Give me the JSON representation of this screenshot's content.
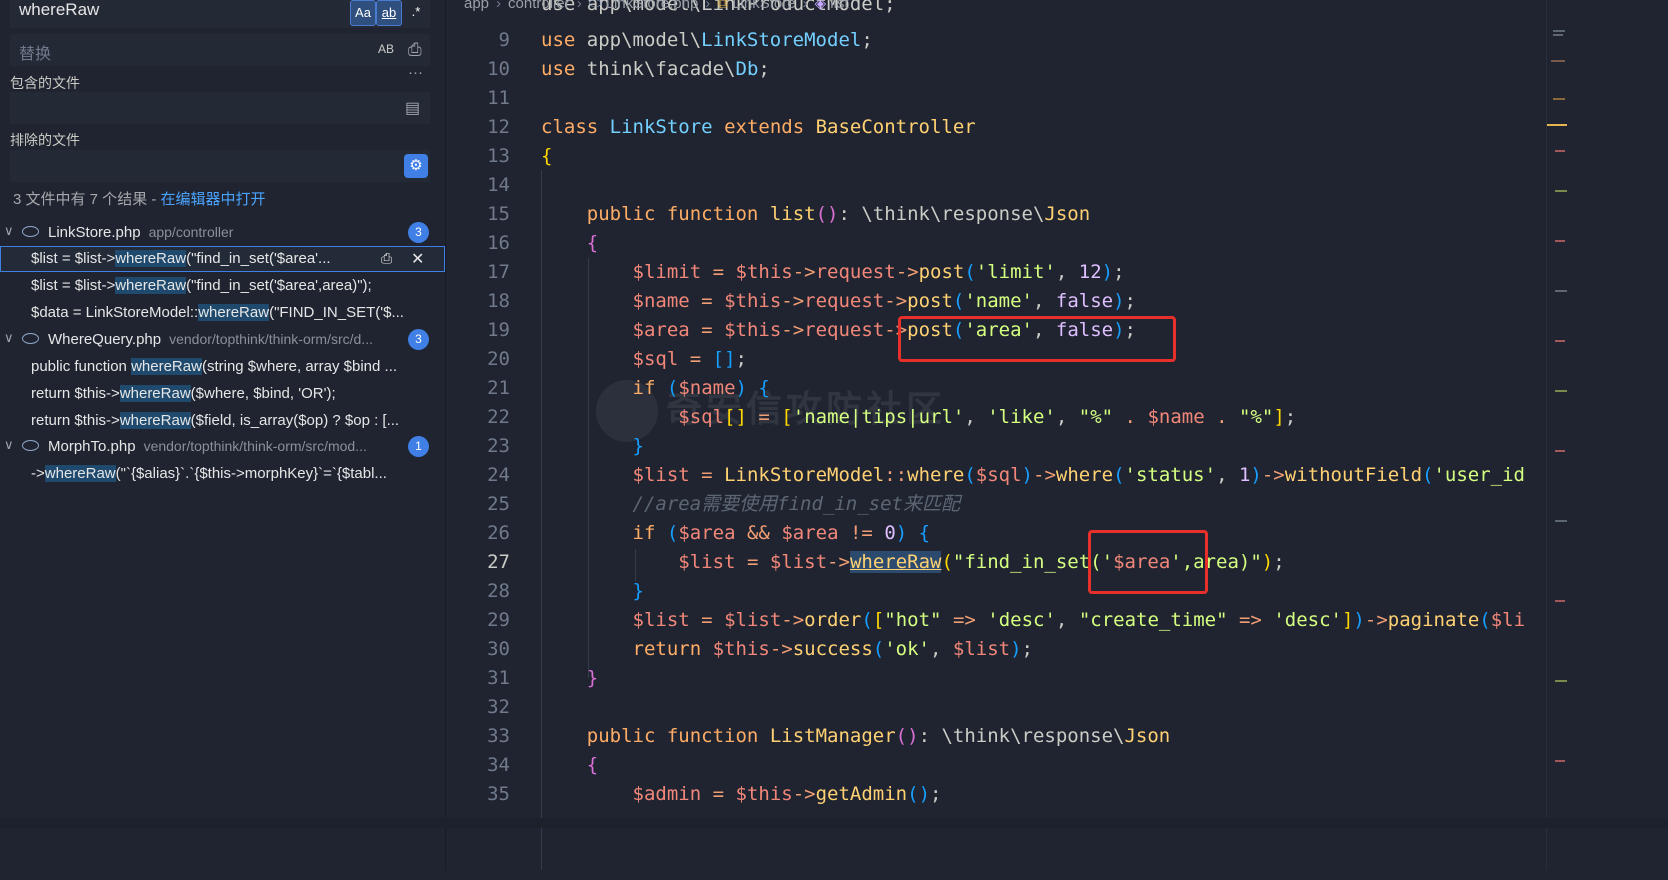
{
  "search": {
    "query": "whereRaw",
    "opt_case": "Aa",
    "opt_word": "ab",
    "opt_regex": ".*",
    "replace_placeholder": "替换",
    "replace_all": "AB",
    "include_label": "包含的文件",
    "exclude_label": "排除的文件",
    "summary": "3 文件中有 7 个结果 - ",
    "open_in_editor": "在编辑器中打开",
    "more": "···"
  },
  "results": [
    {
      "file": "LinkStore.php",
      "path": "app/controller",
      "count": "3",
      "matches": [
        {
          "pre": "$list = $list->",
          "hit": "whereRaw",
          "post": "(\"find_in_set('$area'..."
        },
        {
          "pre": "$list = $list->",
          "hit": "whereRaw",
          "post": "(\"find_in_set('$area',area)\");"
        },
        {
          "pre": "$data = LinkStoreModel::",
          "hit": "whereRaw",
          "post": "(\"FIND_IN_SET('$..."
        }
      ]
    },
    {
      "file": "WhereQuery.php",
      "path": "vendor/topthink/think-orm/src/d...",
      "count": "3",
      "matches": [
        {
          "pre": "public function ",
          "hit": "whereRaw",
          "post": "(string $where, array $bind ..."
        },
        {
          "pre": "return $this->",
          "hit": "whereRaw",
          "post": "($where, $bind, 'OR');"
        },
        {
          "pre": "return $this->",
          "hit": "whereRaw",
          "post": "($field, is_array($op) ? $op : [..."
        }
      ]
    },
    {
      "file": "MorphTo.php",
      "path": "vendor/topthink/think-orm/src/mod...",
      "count": "1",
      "matches": [
        {
          "pre": "->",
          "hit": "whereRaw",
          "post": "(\"`{$alias}`.`{$this->morphKey}`=`{$tabl..."
        }
      ]
    }
  ],
  "breadcrumb": [
    "app",
    "controller",
    "LinkStore.php",
    "LinkStore",
    "list"
  ],
  "editor": {
    "current_line": "27",
    "watermark": "奇安信攻防社区",
    "top_partial": "use app\\model\\LinkProductModel;",
    "line_numbers": [
      "9",
      "10",
      "11",
      "12",
      "13",
      "14",
      "15",
      "16",
      "17",
      "18",
      "19",
      "20",
      "21",
      "22",
      "23",
      "24",
      "25",
      "26",
      "27",
      "28",
      "29",
      "30",
      "31",
      "32",
      "33",
      "34",
      "35"
    ]
  }
}
